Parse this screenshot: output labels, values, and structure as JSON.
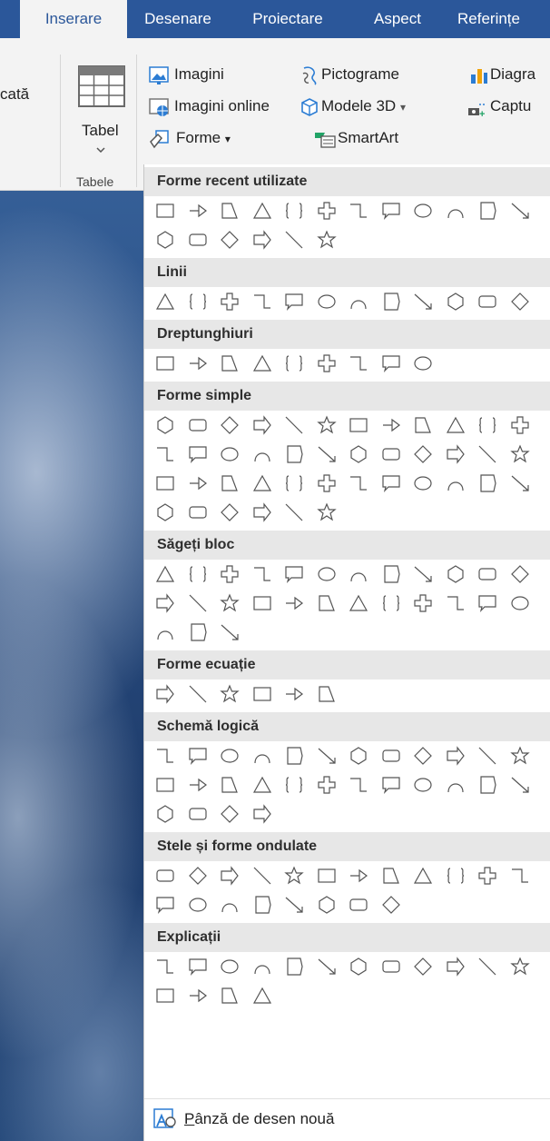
{
  "tabs": [
    "Inserare",
    "Desenare",
    "Proiectare",
    "Aspect",
    "Referințe"
  ],
  "ribbon": {
    "partial_left": "cată",
    "table_label": "Tabel",
    "group_tables": "Tabele",
    "images": "Imagini",
    "online_images": "Imagini online",
    "shapes_button": "Forme",
    "pictograms": "Pictograme",
    "models3d": "Modele 3D",
    "smartart": "SmartArt",
    "diagram_partial": "Diagra",
    "capture_partial": "Captu"
  },
  "sections": [
    {
      "title": "Forme recent utilizate",
      "rows": [
        12,
        6
      ]
    },
    {
      "title": "Linii",
      "rows": [
        12
      ]
    },
    {
      "title": "Dreptunghiuri",
      "rows": [
        9
      ]
    },
    {
      "title": "Forme simple",
      "rows": [
        12,
        12,
        12,
        6
      ]
    },
    {
      "title": "Săgeți bloc",
      "rows": [
        12,
        12,
        3
      ]
    },
    {
      "title": "Forme ecuație",
      "rows": [
        6
      ]
    },
    {
      "title": "Schemă logică",
      "rows": [
        12,
        12,
        4
      ]
    },
    {
      "title": "Stele și forme ondulate",
      "rows": [
        12,
        8
      ]
    },
    {
      "title": "Explicații",
      "rows": [
        12,
        4
      ]
    }
  ],
  "footer": {
    "label": "Pânză de desen nouă",
    "access_key": "P",
    "rest": "ânză de desen nouă"
  },
  "colors": {
    "accent": "#2b579a",
    "icon_blue": "#2b7cd3",
    "shape_stroke": "#555555"
  }
}
